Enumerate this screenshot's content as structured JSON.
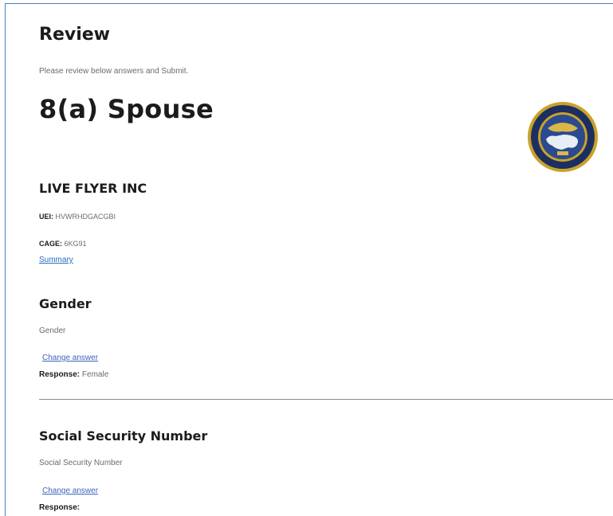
{
  "review": {
    "title": "Review",
    "intro": "Please review below answers and Submit."
  },
  "program": {
    "title": "8(a) Spouse"
  },
  "business": {
    "name": "LIVE FLYER INC",
    "uei_label": "UEI:",
    "uei_value": "HVWRHDGACGBI",
    "cage_label": "CAGE:",
    "cage_value": "6KG91",
    "summary_link": "Summary"
  },
  "questions": [
    {
      "title": "Gender",
      "question": "Gender",
      "change_label": "Change answer",
      "response_label": "Response:",
      "response_value": "Female"
    },
    {
      "title": "Social Security Number",
      "question": "Social Security Number",
      "change_label": "Change answer",
      "response_label": "Response:",
      "response_value": ""
    }
  ],
  "colors": {
    "link": "#2a6ebf",
    "frame_border": "#4a7fc1",
    "seal_navy": "#1c2f63",
    "seal_gold": "#c9a227"
  },
  "icons": {
    "seal": "agency-seal-icon"
  }
}
